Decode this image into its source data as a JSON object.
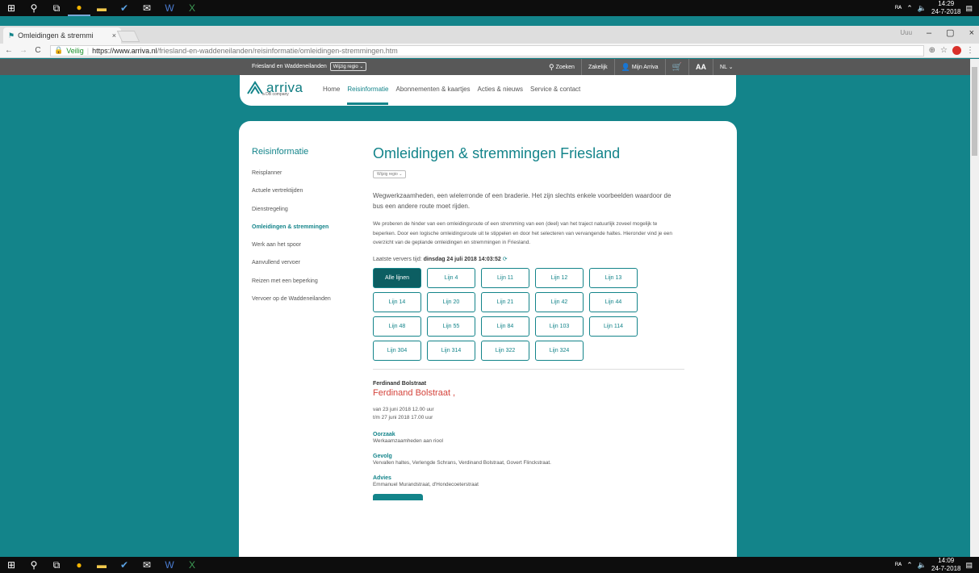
{
  "taskbar": {
    "time": "14:29",
    "date": "24-7-2018",
    "bottom_time": "14:09",
    "bottom_date": "24-7-2018",
    "lang": "ᴿᴬ"
  },
  "browser": {
    "tab_title": "Omleidingen & stremmi",
    "tab_close": "×",
    "user_label": "Uuu",
    "minimize": "–",
    "maximize": "▢",
    "close": "×",
    "secure_label": "Veilig",
    "url_host": "https://www.arriva.nl",
    "url_path": "/friesland-en-waddeneilanden/reisinformatie/omleidingen-stremmingen.htm"
  },
  "sitebar": {
    "region": "Friesland en Waddeneilanden",
    "region_btn": "Wijzig regio ⌄",
    "search": "Zoeken",
    "business": "Zakelijk",
    "my": "Mijn Arriva",
    "fontsize": "AA",
    "lang": "NL ⌄"
  },
  "nav": {
    "logo": "arriva",
    "logo_sub": "a DB company",
    "items": [
      "Home",
      "Reisinformatie",
      "Abonnementen & kaartjes",
      "Acties & nieuws",
      "Service & contact"
    ]
  },
  "sidebar": {
    "title": "Reisinformatie",
    "items": [
      "Reisplanner",
      "Actuele vertrektijden",
      "Dienstregeling",
      "Omleidingen & stremmingen",
      "Werk aan het spoor",
      "Aanvullend vervoer",
      "Reizen met een beperking",
      "Vervoer op de Waddeneilanden"
    ]
  },
  "content": {
    "title": "Omleidingen & stremmingen Friesland",
    "regio_btn": "Wijzig regio ⌄",
    "lead": "Wegwerkzaamheden, een wielerronde of een braderie. Het zijn slechts enkele voorbeelden waardoor de bus een andere route moet rijden.",
    "body": "We proberen de hinder van een omleidingsroute of een stremming van een (deel) van het traject natuurlijk zoveel mogelijk te beperken. Door een logische omleidingsroute uit te stippelen en door het selecteren van vervangende haltes. Hieronder vind je een overzicht van de geplande omleidingen en stremmingen in Friesland.",
    "refresh_label": "Laatste ververs tijd:",
    "refresh_value": "dinsdag 24 juli 2018 14:03:52",
    "lines": [
      "Alle lijnen",
      "Lijn 4",
      "Lijn 11",
      "Lijn 12",
      "Lijn 13",
      "Lijn 14",
      "Lijn 20",
      "Lijn 21",
      "Lijn 42",
      "Lijn 44",
      "Lijn 48",
      "Lijn 55",
      "Lijn 84",
      "Lijn 103",
      "Lijn 114",
      "Lijn 304",
      "Lijn 314",
      "Lijn 322",
      "Lijn 324"
    ],
    "street": "Ferdinand Bolstraat",
    "street_red": "Ferdinand Bolstraat ,",
    "date_from": "van 23 juni 2018 12.00 uur",
    "date_to": "t/m 27 juni 2018 17.00 uur",
    "cause_h": "Oorzaak",
    "cause_t": "Werkaamzaamheden aan riool",
    "effect_h": "Gevolg",
    "effect_t": "Vervallen haltes, Verlengde Schrans, Verdinand Bolstraat, Govert Flinckstraat.",
    "advice_h": "Advies",
    "advice_t": "Emmanuel Murandstraat, d'Hondecoeterstraat"
  },
  "colors": {
    "accent": "#13848a",
    "red": "#d4433b",
    "dark_btn": "#0c5e62"
  }
}
